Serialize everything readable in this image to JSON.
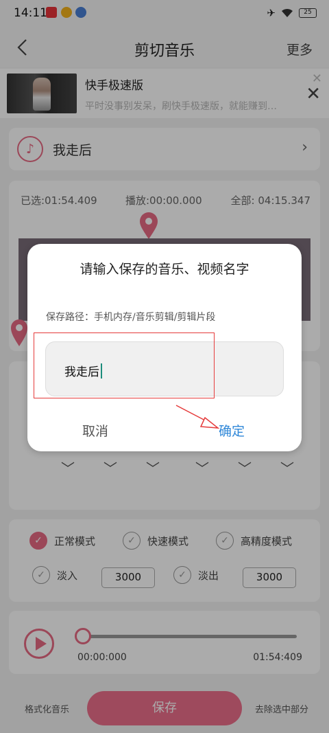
{
  "statusbar": {
    "time": "14:11",
    "battery": "25"
  },
  "navbar": {
    "title": "剪切音乐",
    "more": "更多"
  },
  "ad": {
    "title": "快手极速版",
    "desc": "平时没事别发呆，刷快手极速版，就能赚到…"
  },
  "song": {
    "name": "我走后"
  },
  "timeline": {
    "selected": "已选:01:54.409",
    "playing": "播放:00:00.000",
    "total": "全部: 04:15.347"
  },
  "modes": {
    "normal": "正常模式",
    "fast": "快速模式",
    "precise": "高精度模式"
  },
  "fade": {
    "in_label": "淡入",
    "in_value": "3000",
    "out_label": "淡出",
    "out_value": "3000"
  },
  "player": {
    "start": "00:00:000",
    "end": "01:54:409"
  },
  "bottom": {
    "format": "格式化音乐",
    "save": "保存",
    "remove": "去除选中部分"
  },
  "dialog": {
    "title": "请输入保存的音乐、视频名字",
    "path": "保存路径：手机内存/音乐剪辑/剪辑片段",
    "input_value": "我走后",
    "cancel": "取消",
    "ok": "确定"
  },
  "colors": {
    "accent": "#e86a83",
    "ok_blue": "#2f87d8",
    "annotation": "#e53a3a"
  }
}
